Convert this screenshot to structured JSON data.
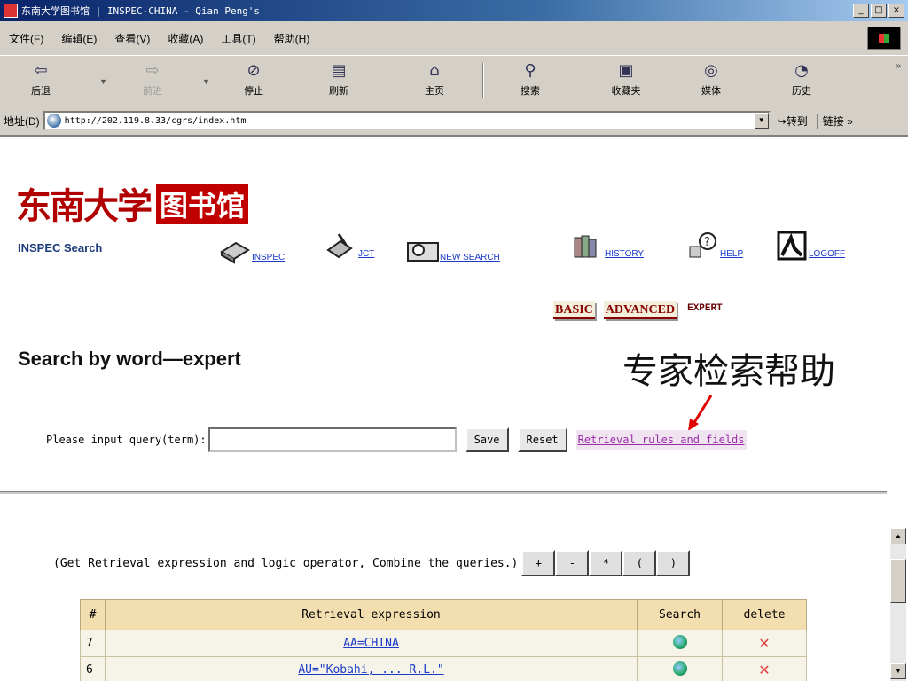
{
  "window": {
    "title": "东南大学图书馆 | INSPEC-CHINA - Qian Peng's",
    "minimize": "_",
    "maximize": "□",
    "close": "×"
  },
  "menu": [
    "文件(F)",
    "编辑(E)",
    "查看(V)",
    "收藏(A)",
    "工具(T)",
    "帮助(H)"
  ],
  "toolbar": {
    "back": "后退",
    "forward": "前进",
    "stop": "停止",
    "refresh": "刷新",
    "home": "主页",
    "search": "搜索",
    "favorites": "收藏夹",
    "media": "媒体",
    "history": "历史",
    "more": "»"
  },
  "address": {
    "label": "地址(D)",
    "url": "http://202.119.8.33/cgrs/index.htm",
    "go": "转到",
    "links": "链接 »"
  },
  "page": {
    "logo_name": "东南大学",
    "logo_boxed": "图书馆",
    "inspec_label": "INSPEC Search",
    "nav": {
      "inspec": "INSPEC",
      "jct": "JCT",
      "new_search": "NEW SEARCH",
      "history": "HISTORY",
      "help": "HELP",
      "logoff": "LOGOFF"
    },
    "modes": {
      "basic": "BASIC",
      "advanced": "ADVANCED",
      "expert": "EXPERT"
    },
    "section_title": "Search by word—expert",
    "annotation": "专家检索帮助",
    "query": {
      "label": "Please input query(term):",
      "value": "",
      "save": "Save",
      "reset": "Reset",
      "rules_link": "Retrieval rules and fields"
    },
    "combine": {
      "label": "(Get Retrieval expression and logic operator, Combine the queries.)",
      "ops": [
        "+",
        "-",
        "*",
        "(",
        ")"
      ]
    },
    "results": {
      "headers": [
        "#",
        "Retrieval expression",
        "Search",
        "delete"
      ],
      "rows": [
        {
          "num": "7",
          "expr": "AA=CHINA"
        },
        {
          "num": "6",
          "expr": "AU=\"Kobahi, ... R.L.\""
        }
      ]
    }
  },
  "colors": {
    "accent_red": "#b00000",
    "link_blue": "#1a3ac8",
    "visited_purple": "#9b2ca8",
    "table_header": "#f3deb0"
  }
}
